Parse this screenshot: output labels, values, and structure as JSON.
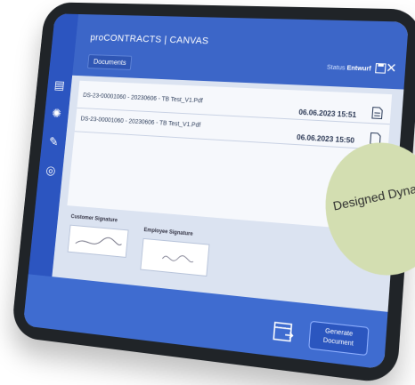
{
  "app": {
    "title": "proCONTRACTS | CANVAS"
  },
  "toolbar": {
    "documents_label": "Documents",
    "status_label": "Status",
    "status_value": "Entwurf"
  },
  "documents": [
    {
      "name": "DS-23-00001060 - 20230606 - TB Test_V1.Pdf",
      "date": "06.06.2023 15:51"
    },
    {
      "name": "DS-23-00001060 - 20230606 - TB Test_V1.Pdf",
      "date": "06.06.2023 15:50"
    }
  ],
  "signatures": {
    "customer_label": "Customer Signature",
    "employee_label": "Employee Signature"
  },
  "actions": {
    "generate_label": "Generate Document"
  },
  "badge": {
    "text": "Designed Dynamic"
  },
  "icons": [
    "documents-icon",
    "settings-icon",
    "sign-icon",
    "products-icon",
    "save-icon",
    "close-icon",
    "file-icon",
    "generate-icon"
  ],
  "colors": {
    "primary": "#3c66c8",
    "badge": "#d3deb1"
  }
}
